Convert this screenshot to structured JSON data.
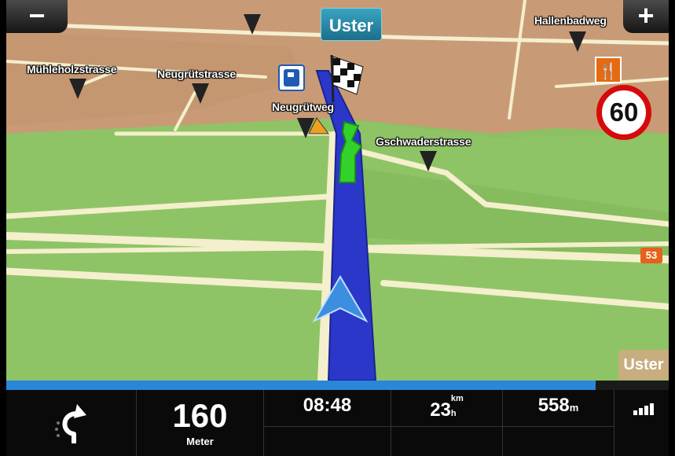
{
  "map": {
    "destination_tab": "Uster",
    "speed_limit": "60",
    "side_label": "Uster",
    "road_number": "53",
    "street_labels": [
      "Mühleholzstrasse",
      "Neugrütstrasse",
      "Neugrütweg",
      "Gschwaderstrasse",
      "Hallenbadweg"
    ]
  },
  "controls": {
    "zoom_out": "−",
    "zoom_in": "+"
  },
  "route_progress_fraction": 0.89,
  "bottom": {
    "distance_value": "160",
    "distance_unit": "Meter",
    "time": "08:48",
    "remaining_value": "23",
    "remaining_unit_top": "km",
    "remaining_unit_bottom": "h",
    "total_value": "558",
    "total_unit": "m"
  },
  "colors": {
    "route": "#2b37c9",
    "next_segment": "#33d22a",
    "progress": "#2a86d8"
  },
  "icons": [
    "fuel-station-icon",
    "restaurant-icon",
    "checkered-flag-icon",
    "position-arrow-icon",
    "u-turn-icon",
    "signal-icon"
  ]
}
